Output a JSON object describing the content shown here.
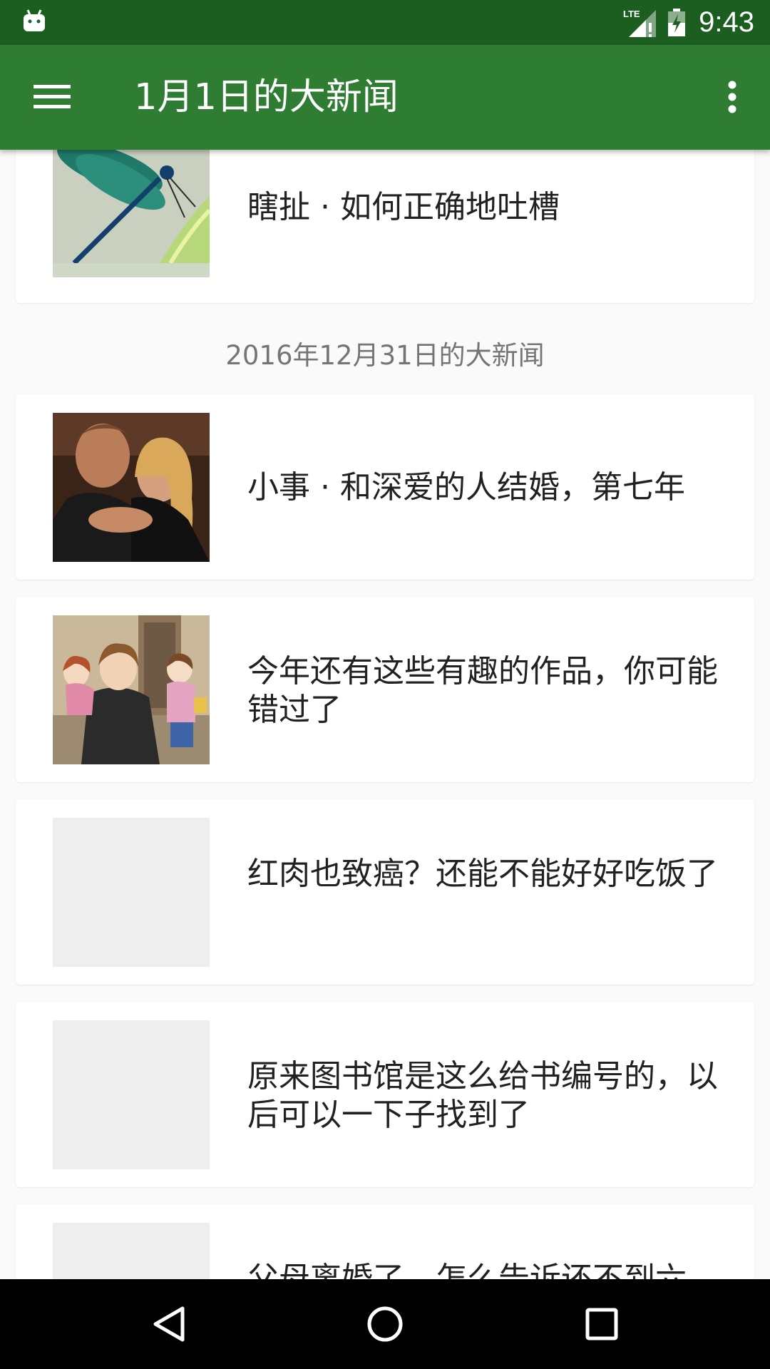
{
  "status_bar": {
    "time": "9:43",
    "network": "LTE",
    "icons": [
      "android-icon",
      "lte-signal-icon",
      "battery-icon"
    ]
  },
  "app_bar": {
    "title": "1月1日的大新闻",
    "menu_icon": "menu-icon",
    "more_icon": "more-vert-icon"
  },
  "feed": {
    "top_card": {
      "title": "瞎扯 · 如何正确地吐槽",
      "thumb": "dragonfly-photo"
    },
    "section_date": "2016年12月31日的大新闻",
    "stories": [
      {
        "title": "小事 · 和深爱的人结婚，第七年",
        "thumb": "couple-photo"
      },
      {
        "title": "今年还有这些有趣的作品，你可能错过了",
        "thumb": "anime-family-illustration"
      },
      {
        "title": "红肉也致癌？还能不能好好吃饭了",
        "thumb": "image-placeholder"
      },
      {
        "title": "原来图书馆是这么给书编号的，以后可以一下子找到了",
        "thumb": "image-placeholder"
      },
      {
        "title": "父母离婚了，怎么告诉还不到六",
        "thumb": "image-placeholder"
      }
    ]
  },
  "nav_bar": {
    "buttons": [
      "back-icon",
      "home-icon",
      "recents-icon"
    ]
  },
  "colors": {
    "status_bar": "#1b5e20",
    "app_bar": "#2e7d32",
    "background": "#fafafa",
    "card": "#ffffff",
    "placeholder": "#eeeeee",
    "date_text": "#757575",
    "nav_bar": "#000000"
  }
}
